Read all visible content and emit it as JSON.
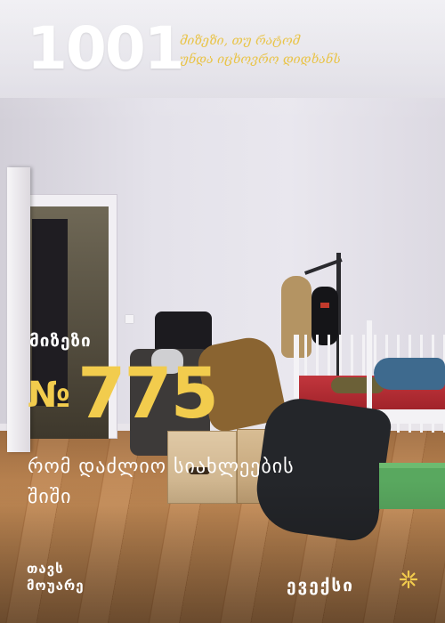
{
  "header": {
    "number": "1001",
    "tagline": [
      "მიზეზი, თუ რატომ",
      "უნდა იცხოვრო დიდხანს"
    ]
  },
  "reason": {
    "label": "მიზეზი",
    "number_prefix": "№",
    "number": "775",
    "text": [
      "რომ დაძლიო სიახლეების",
      "შიში"
    ]
  },
  "brand": {
    "left_logo": [
      "თავს",
      "მოუარე"
    ],
    "right_logo": "ევექსი"
  },
  "colors": {
    "accent_yellow": "#f2cc4d",
    "text_white": "#ffffff"
  },
  "icons": {
    "brand_mark": "star-burst-icon"
  }
}
